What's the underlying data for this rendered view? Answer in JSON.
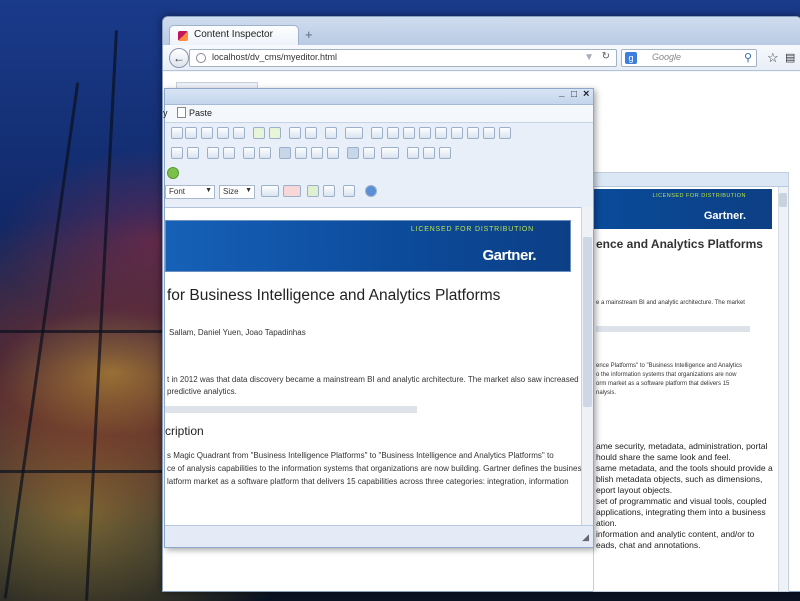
{
  "browser": {
    "tab_title": "Content Inspector",
    "new_tab": "+",
    "url": "localhost/dv_cms/myeditor.html",
    "search_placeholder": "Google",
    "search_engine_icon": "g-icon"
  },
  "editor": {
    "menu": {
      "copy_partial": "y",
      "paste": "Paste"
    },
    "window_controls": {
      "minimize": "_",
      "maximize": "□",
      "close": "×"
    },
    "font_select": "Font",
    "size_select": "Size",
    "banner": {
      "licensed": "LICENSED FOR DISTRIBUTION",
      "brand": "Gartner."
    },
    "doc": {
      "title": "for Business Intelligence and Analytics Platforms",
      "authors": "Sallam, Daniel Yuen, Joao Tapadinhas",
      "p1_l1": "t in 2012 was that data discovery became a mainstream BI and analytic architecture. The market also saw increased",
      "p1_l2": "predictive analytics.",
      "h2": "cription",
      "p2_l1": "s Magic Quadrant from \"Business Intelligence Platforms\" to \"Business Intelligence and Analytics Platforms\" to",
      "p2_l2": "ce of analysis capabilities to the information systems that organizations are now building. Gartner defines the business",
      "p2_l3": "latform market as a software platform that delivers 15 capabilities across three categories: integration, information"
    }
  },
  "behind_page": {
    "banner": {
      "licensed": "LICENSED FOR DISTRIBUTION",
      "brand": "Gartner."
    },
    "title": "ence and Analytics Platforms",
    "p1": "e a mainstream BI and analytic architecture. The market",
    "p2_l1": "ence Platforms\" to \"Business Intelligence and Analytics",
    "p2_l2": "o the information systems that organizations are now",
    "p2_l3": "orm market as a software platform that delivers 15",
    "p2_l4": "nalysis.",
    "q1": "ame security, metadata, administration, portal",
    "q2": "hould share the same look and feel.",
    "q3": "same metadata, and the tools should provide a",
    "q4": "blish metadata objects, such as dimensions,",
    "q5": "eport layout objects.",
    "q6": "set of programmatic and visual tools, coupled",
    "q7": "applications, integrating them into a business",
    "q8": "ation.",
    "q9": "information and analytic content, and/or to",
    "q10": "eads, chat and annotations."
  }
}
